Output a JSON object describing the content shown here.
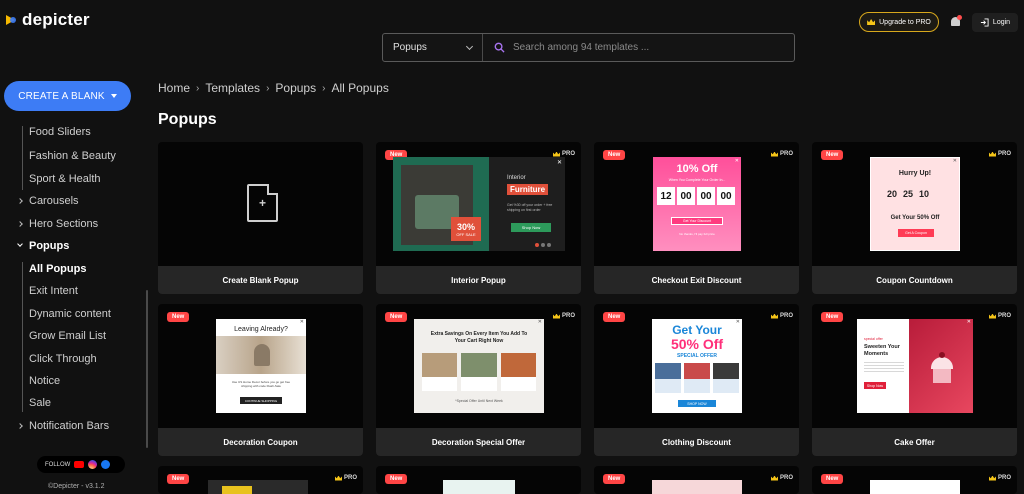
{
  "app": {
    "name": "depicter"
  },
  "search": {
    "category_value": "Popups",
    "placeholder": "Search among 94 templates ..."
  },
  "header": {
    "upgrade_label": "Upgrade to PRO",
    "login_label": "Login"
  },
  "sidebar": {
    "create_label": "CREATE A BLANK",
    "items": [
      {
        "label": "Food Sliders",
        "kind": "child"
      },
      {
        "label": "Fashion & Beauty",
        "kind": "child"
      },
      {
        "label": "Sport & Health",
        "kind": "child"
      },
      {
        "label": "Carousels",
        "kind": "parent"
      },
      {
        "label": "Hero Sections",
        "kind": "parent"
      },
      {
        "label": "Popups",
        "kind": "parent-open"
      },
      {
        "label": "All Popups",
        "kind": "child-active"
      },
      {
        "label": "Exit Intent",
        "kind": "child"
      },
      {
        "label": "Dynamic content",
        "kind": "child"
      },
      {
        "label": "Grow Email List",
        "kind": "child"
      },
      {
        "label": "Click Through",
        "kind": "child"
      },
      {
        "label": "Notice",
        "kind": "child"
      },
      {
        "label": "Sale",
        "kind": "child"
      },
      {
        "label": "Notification Bars",
        "kind": "parent"
      }
    ],
    "follow_label": "FOLLOW",
    "copyright": "©Depicter - v3.1.2"
  },
  "breadcrumb": [
    "Home",
    "Templates",
    "Popups",
    "All Popups"
  ],
  "page_title": "Popups",
  "badges": {
    "new": "New",
    "pro": "PRO"
  },
  "cards": [
    {
      "title": "Create Blank Popup"
    },
    {
      "title": "Interior Popup",
      "thumb": {
        "heading": "Interior",
        "accent": "Furniture",
        "body": "Get %30 off your order + free shipping on first order",
        "cta": "Shop Now",
        "sale_pct": "30%",
        "sale_word": "OFF SALE"
      }
    },
    {
      "title": "Checkout Exit Discount",
      "thumb": {
        "heading": "10% Off",
        "sub": "When You Complete Your Order In...",
        "timer": [
          "12",
          "00",
          "00",
          "00"
        ],
        "cta": "Get Your Discount",
        "link": "No thanks, I'll pay full price"
      }
    },
    {
      "title": "Coupon Countdown",
      "thumb": {
        "heading": "Hurry Up!",
        "timer": [
          "20",
          "25",
          "10"
        ],
        "offer": "Get Your 50% Off",
        "cta": "Get A Coupon"
      }
    },
    {
      "title": "Decoration Coupon",
      "thumb": {
        "heading": "Leaving Already?",
        "body": "Use US Home Decor before you go get free shipping with code Flash-Sale",
        "cta": "CONTINUE SHOPPING"
      }
    },
    {
      "title": "Decoration Special Offer",
      "thumb": {
        "heading": "Extra Savings On Every Item You Add To Your Cart Right Now",
        "footer": "*Special Offer Until Next Week"
      }
    },
    {
      "title": "Clothing Discount",
      "thumb": {
        "heading": "Get Your",
        "big": "50% Off",
        "sub": "SPECIAL OFFER",
        "cta": "SHOP NOW"
      }
    },
    {
      "title": "Cake Offer",
      "thumb": {
        "tag": "special offer",
        "heading": "Sweeten Your Moments",
        "cta": "Shop Now"
      }
    }
  ],
  "colors": {
    "accent": "#3d7cf5",
    "new_badge": "#ff4545",
    "pro_crown": "#f5c518",
    "background": "#111111",
    "card_label_bg": "#262626"
  }
}
